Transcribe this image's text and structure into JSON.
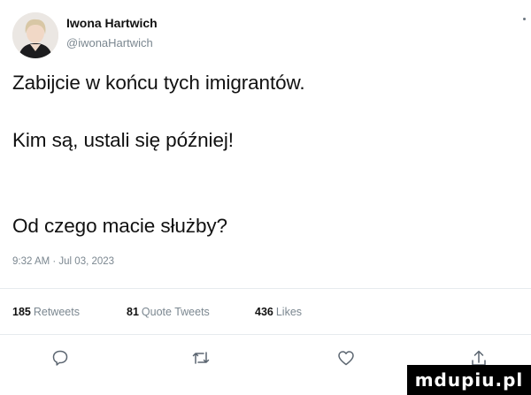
{
  "author": {
    "name": "Iwona Hartwich",
    "handle": "@iwonaHartwich"
  },
  "tweet": {
    "lines": [
      "Zabijcie w końcu tych imigrantów.",
      "Kim są, ustali się później!",
      "Od czego macie służby?"
    ],
    "timestamp": "9:32 AM · Jul 03, 2023"
  },
  "stats": {
    "retweets": {
      "count": "185",
      "label": "Retweets"
    },
    "quote_tweets": {
      "count": "81",
      "label": "Quote Tweets"
    },
    "likes": {
      "count": "436",
      "label": "Likes"
    }
  },
  "actions": [
    "reply-icon",
    "retweet-icon",
    "like-icon",
    "share-icon"
  ],
  "watermark": {
    "text": "mdupiu.pl"
  },
  "colors": {
    "text": "#111111",
    "secondary": "#7b8790",
    "divider": "#e6ebee",
    "background": "#ffffff"
  }
}
